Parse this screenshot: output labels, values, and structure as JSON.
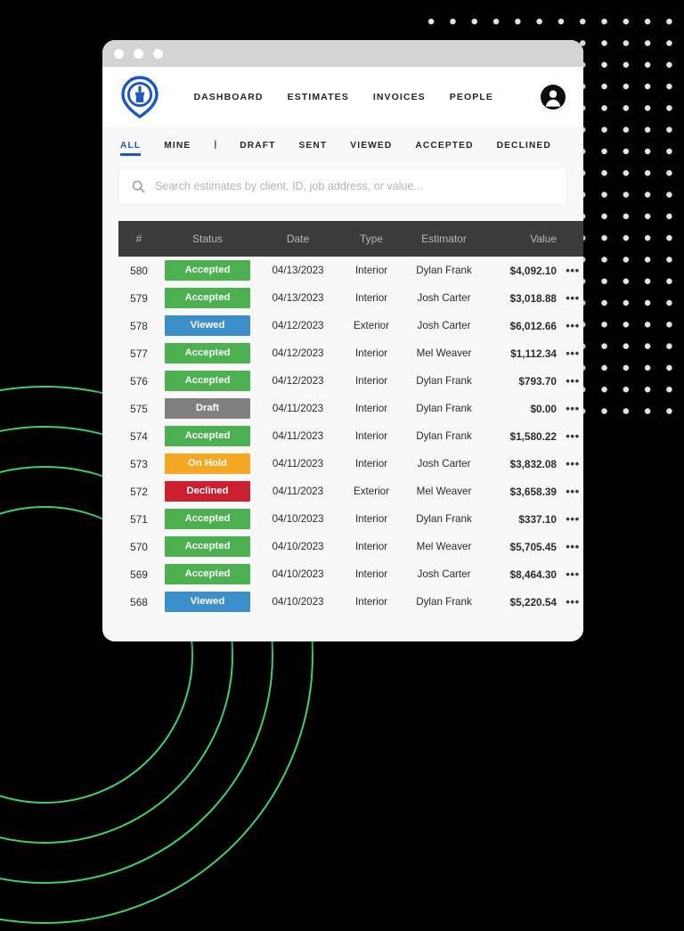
{
  "window": {
    "titlebar_dots": [
      "close",
      "minimize",
      "maximize"
    ]
  },
  "brand": {
    "logo_icon": "paintbrush-map-pin-logo",
    "logo_color": "#1a56c4"
  },
  "topnav": {
    "links": [
      {
        "label": "DASHBOARD"
      },
      {
        "label": "ESTIMATES"
      },
      {
        "label": "INVOICES"
      },
      {
        "label": "PEOPLE"
      }
    ],
    "avatar_icon": "user-avatar-icon"
  },
  "tabs": {
    "items": [
      {
        "label": "ALL",
        "active": true
      },
      {
        "label": "MINE",
        "active": false
      },
      {
        "label": "DRAFT",
        "active": false
      },
      {
        "label": "SENT",
        "active": false
      },
      {
        "label": "VIEWED",
        "active": false
      },
      {
        "label": "ACCEPTED",
        "active": false
      },
      {
        "label": "DECLINED",
        "active": false
      }
    ],
    "separator": "|",
    "active_color": "#1a56c4"
  },
  "search": {
    "icon": "search-icon",
    "placeholder": "Search estimates by client, ID, job address, or value...",
    "value": ""
  },
  "table": {
    "header_bg": "#3b3b3b",
    "columns": [
      {
        "key": "num",
        "label": "#"
      },
      {
        "key": "status",
        "label": "Status"
      },
      {
        "key": "date",
        "label": "Date"
      },
      {
        "key": "type",
        "label": "Type"
      },
      {
        "key": "estimator",
        "label": "Estimator"
      },
      {
        "key": "value",
        "label": "Value"
      }
    ],
    "status_colors": {
      "Accepted": "#4caf50",
      "Viewed": "#3d8fc9",
      "Draft": "#808080",
      "On Hold": "#f5a623",
      "Declined": "#cc2030"
    },
    "row_menu_icon": "more-options-icon",
    "row_menu_glyph": "•••",
    "rows": [
      {
        "num": "580",
        "status": "Accepted",
        "date": "04/13/2023",
        "type": "Interior",
        "estimator": "Dylan Frank",
        "value": "$4,092.10"
      },
      {
        "num": "579",
        "status": "Accepted",
        "date": "04/13/2023",
        "type": "Interior",
        "estimator": "Josh Carter",
        "value": "$3,018.88"
      },
      {
        "num": "578",
        "status": "Viewed",
        "date": "04/12/2023",
        "type": "Exterior",
        "estimator": "Josh Carter",
        "value": "$6,012.66"
      },
      {
        "num": "577",
        "status": "Accepted",
        "date": "04/12/2023",
        "type": "Interior",
        "estimator": "Mel Weaver",
        "value": "$1,112.34"
      },
      {
        "num": "576",
        "status": "Accepted",
        "date": "04/12/2023",
        "type": "Interior",
        "estimator": "Dylan Frank",
        "value": "$793.70"
      },
      {
        "num": "575",
        "status": "Draft",
        "date": "04/11/2023",
        "type": "Interior",
        "estimator": "Dylan Frank",
        "value": "$0.00"
      },
      {
        "num": "574",
        "status": "Accepted",
        "date": "04/11/2023",
        "type": "Interior",
        "estimator": "Dylan Frank",
        "value": "$1,580.22"
      },
      {
        "num": "573",
        "status": "On Hold",
        "date": "04/11/2023",
        "type": "Interior",
        "estimator": "Josh Carter",
        "value": "$3,832.08"
      },
      {
        "num": "572",
        "status": "Declined",
        "date": "04/11/2023",
        "type": "Exterior",
        "estimator": "Mel Weaver",
        "value": "$3,658.39"
      },
      {
        "num": "571",
        "status": "Accepted",
        "date": "04/10/2023",
        "type": "Interior",
        "estimator": "Dylan Frank",
        "value": "$337.10"
      },
      {
        "num": "570",
        "status": "Accepted",
        "date": "04/10/2023",
        "type": "Interior",
        "estimator": "Mel Weaver",
        "value": "$5,705.45"
      },
      {
        "num": "569",
        "status": "Accepted",
        "date": "04/10/2023",
        "type": "Interior",
        "estimator": "Josh Carter",
        "value": "$8,464.30"
      },
      {
        "num": "568",
        "status": "Viewed",
        "date": "04/10/2023",
        "type": "Interior",
        "estimator": "Dylan Frank",
        "value": "$5,220.54"
      }
    ]
  },
  "decorations": {
    "dot_grid_color": "#e3e3e3",
    "ring_color": "#3ed16a",
    "background_color": "#000000"
  }
}
